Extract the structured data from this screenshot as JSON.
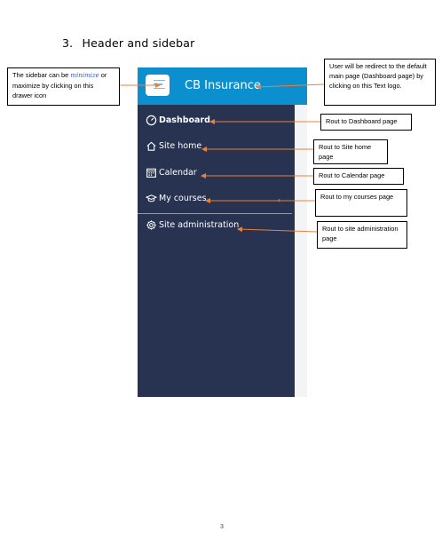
{
  "section": {
    "number": "3.",
    "title": "Header and sidebar"
  },
  "header": {
    "brand": "CB Insurance"
  },
  "sidebar": {
    "items": [
      {
        "label": "Dashboard",
        "icon": "gauge-icon"
      },
      {
        "label": "Site home",
        "icon": "home-icon"
      },
      {
        "label": "Calendar",
        "icon": "calendar-icon"
      },
      {
        "label": "My courses",
        "icon": "graduation-cap-icon"
      },
      {
        "label": "Site administration",
        "icon": "gear-icon"
      }
    ],
    "chevron": "‹"
  },
  "callouts": {
    "drawer_prefix": "The sidebar can be ",
    "drawer_mini": "minimize",
    "drawer_rest": "or maximize by clicking on this drawer icon",
    "logo": "User will be redirect to the default main page (Dashboard page) by clicking on this Text logo.",
    "dashboard": "Rout to Dashboard page",
    "site_home": "Rout to Site home page",
    "calendar": "Rout to Calendar page",
    "my_courses": "Rout to my courses page",
    "site_admin": "Rout to site administration page"
  },
  "page_number": "3",
  "colors": {
    "header": "#0c8fcf",
    "sidebar": "#273351",
    "arrow": "#e8823a"
  }
}
